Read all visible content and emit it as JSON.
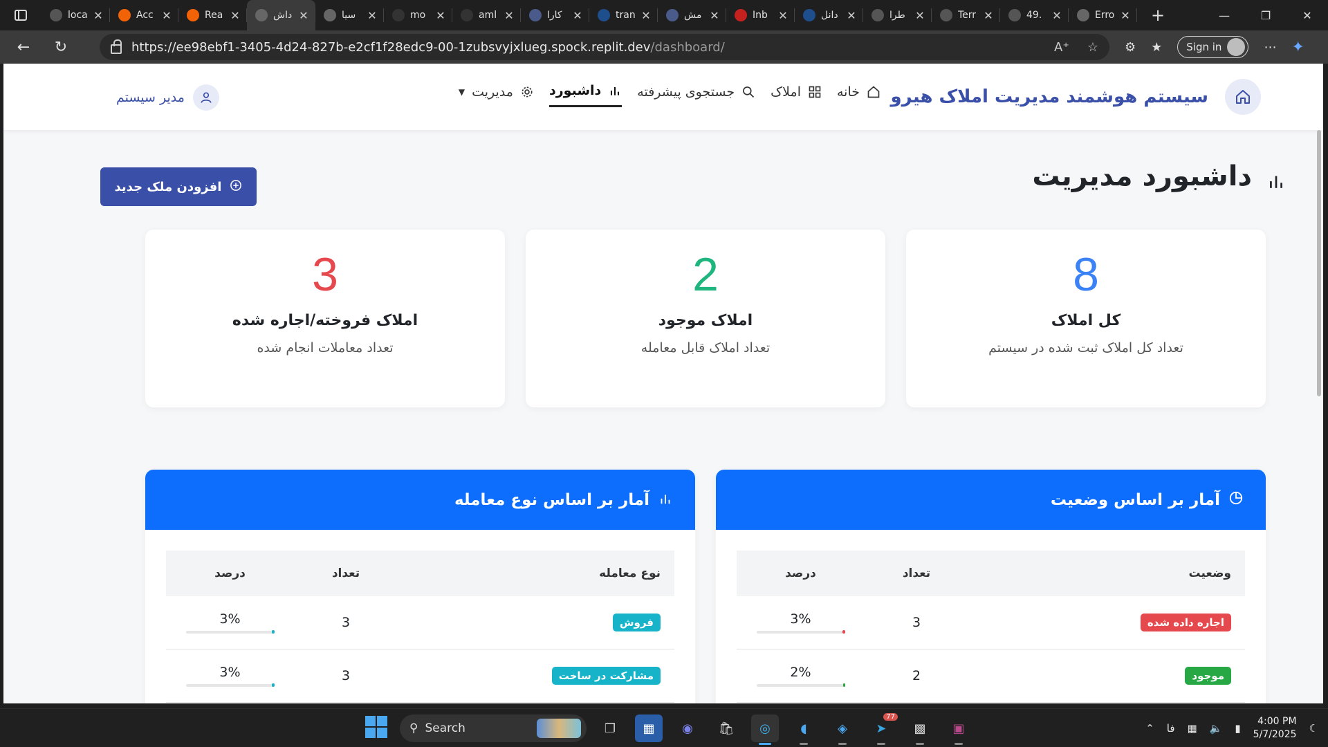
{
  "browser": {
    "tabs": [
      {
        "title": "loca",
        "icon": "document-icon",
        "color": "#555555"
      },
      {
        "title": "Acc",
        "icon": "replit-icon",
        "color": "#f26207"
      },
      {
        "title": "Rea",
        "icon": "replit-icon",
        "color": "#f26207"
      },
      {
        "title": "داش",
        "icon": "globe-icon",
        "color": "#666666",
        "active": true
      },
      {
        "title": "سیا",
        "icon": "globe-icon",
        "color": "#666666"
      },
      {
        "title": "mo",
        "icon": "github-icon",
        "color": "#333333"
      },
      {
        "title": "aml",
        "icon": "github-icon",
        "color": "#333333"
      },
      {
        "title": "کارا",
        "icon": "app-icon",
        "color": "#4a5a8a"
      },
      {
        "title": "tran",
        "icon": "search-icon",
        "color": "#1f4e8c"
      },
      {
        "title": "مش",
        "icon": "app-icon",
        "color": "#4a5a8a"
      },
      {
        "title": "Inb",
        "icon": "gmail-icon",
        "color": "#c5221f"
      },
      {
        "title": "دانل",
        "icon": "search-icon",
        "color": "#1f4e8c"
      },
      {
        "title": "طرا",
        "icon": "openai-icon",
        "color": "#555555"
      },
      {
        "title": "Terr",
        "icon": "cloud-icon",
        "color": "#555555"
      },
      {
        "title": "49.",
        "icon": "document-icon",
        "color": "#555555"
      },
      {
        "title": "Erro",
        "icon": "globe-icon",
        "color": "#666666"
      }
    ],
    "url_host": "https://ee98ebf1-3405-4d24-827b-e2cf1f28edc9-00-1zubsvyjxlueg.spock.replit.dev",
    "url_path": "/dashboard/",
    "signin_label": "Sign in"
  },
  "site": {
    "brand_title": "سیستم هوشمند مدیریت املاک هیرو",
    "menu": [
      {
        "label": "خانه",
        "icon": "home-icon"
      },
      {
        "label": "املاک",
        "icon": "grid-icon"
      },
      {
        "label": "جستجوی پیشرفته",
        "icon": "search-icon"
      },
      {
        "label": "داشبورد",
        "icon": "bar-chart-icon",
        "active": true
      },
      {
        "label": "مدیریت",
        "icon": "gear-icon",
        "dropdown": true
      }
    ],
    "user_name": "مدیر سیستم"
  },
  "dashboard": {
    "title": "داشبورد مدیریت",
    "add_button_label": "افزودن ملک جدید",
    "stats": [
      {
        "value": "8",
        "label": "کل املاک",
        "desc": "تعداد کل املاک ثبت شده در سیستم",
        "color": "#3b82f6"
      },
      {
        "value": "2",
        "label": "املاک موجود",
        "desc": "تعداد املاک قابل معامله",
        "color": "#1fb57e"
      },
      {
        "value": "3",
        "label": "املاک فروخته/اجاره شده",
        "desc": "تعداد معاملات انجام شده",
        "color": "#e5484d"
      }
    ],
    "status_panel": {
      "title": "آمار بر اساس وضعیت",
      "headers": [
        "وضعیت",
        "تعداد",
        "درصد"
      ],
      "rows": [
        {
          "name": "اجاره داده شده",
          "count": "3",
          "percent": "3%",
          "fraction": 0.03,
          "badge_color": "#e5484d"
        },
        {
          "name": "موجود",
          "count": "2",
          "percent": "2%",
          "fraction": 0.02,
          "badge_color": "#28a745"
        }
      ]
    },
    "type_panel": {
      "title": "آمار بر اساس نوع معامله",
      "headers": [
        "نوع معامله",
        "تعداد",
        "درصد"
      ],
      "rows": [
        {
          "name": "فروش",
          "count": "3",
          "percent": "3%",
          "fraction": 0.03,
          "badge_color": "#17b3c9"
        },
        {
          "name": "مشارکت در ساخت",
          "count": "3",
          "percent": "3%",
          "fraction": 0.03,
          "badge_color": "#17b3c9"
        }
      ]
    }
  },
  "taskbar": {
    "search_label": "Search",
    "language": "فا",
    "time": "4:00 PM",
    "date": "5/7/2025",
    "telegram_badge": "77"
  }
}
